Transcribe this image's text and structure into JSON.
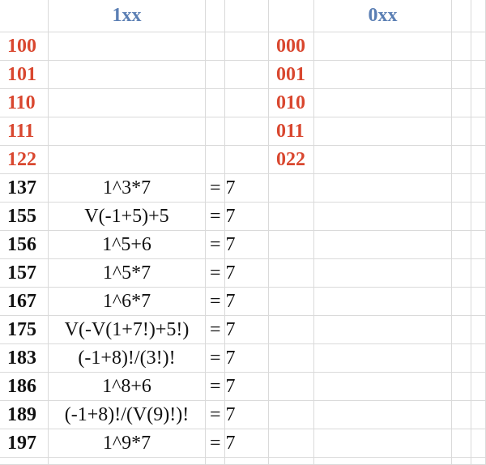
{
  "headers": {
    "col_1xx": "1xx",
    "col_0xx": "0xx"
  },
  "red_rows": [
    {
      "left": "100",
      "right": "000"
    },
    {
      "left": "101",
      "right": "001"
    },
    {
      "left": "110",
      "right": "010"
    },
    {
      "left": "111",
      "right": "011"
    },
    {
      "left": "122",
      "right": "022"
    }
  ],
  "formula_rows": [
    {
      "num": "137",
      "expr": "1^3*7",
      "eq": "= 7"
    },
    {
      "num": "155",
      "expr": "V(-1+5)+5",
      "eq": "= 7"
    },
    {
      "num": "156",
      "expr": "1^5+6",
      "eq": "= 7"
    },
    {
      "num": "157",
      "expr": "1^5*7",
      "eq": "= 7"
    },
    {
      "num": "167",
      "expr": "1^6*7",
      "eq": "= 7"
    },
    {
      "num": "175",
      "expr": "V(-V(1+7!)+5!)",
      "eq": "= 7"
    },
    {
      "num": "183",
      "expr": "(-1+8)!/(3!)!",
      "eq": "= 7"
    },
    {
      "num": "186",
      "expr": "1^8+6",
      "eq": "= 7"
    },
    {
      "num": "189",
      "expr": "(-1+8)!/(V(9)!)!",
      "eq": "= 7"
    },
    {
      "num": "197",
      "expr": "1^9*7",
      "eq": "= 7"
    }
  ],
  "colors": {
    "header": "#5b7fb4",
    "red_number": "#d9472f",
    "black_number": "#111111",
    "gridline": "#dadada"
  }
}
